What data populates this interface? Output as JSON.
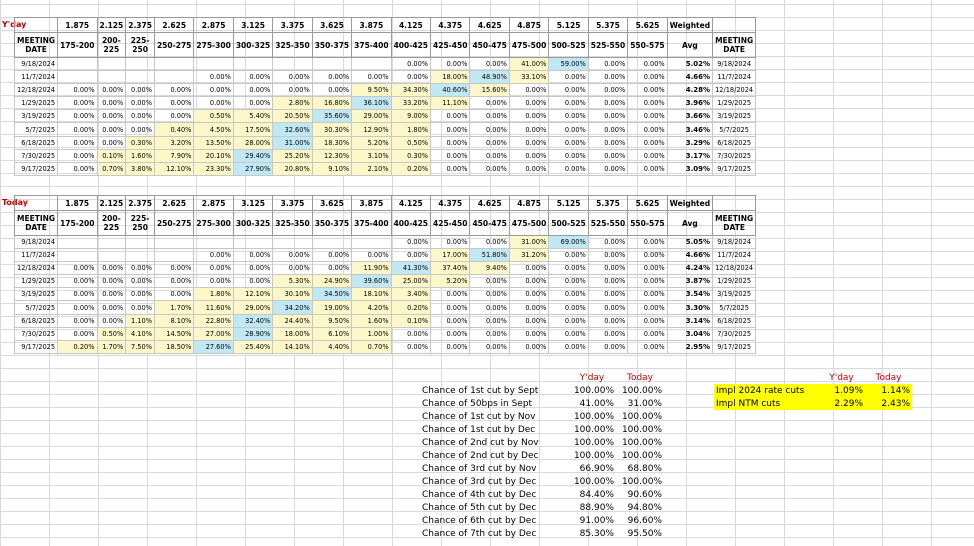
{
  "bucket_mids": [
    "1.875",
    "2.125",
    "2.375",
    "2.625",
    "2.875",
    "3.125",
    "3.375",
    "3.625",
    "3.875",
    "4.125",
    "4.375",
    "4.625",
    "4.875",
    "5.125",
    "5.375",
    "5.625"
  ],
  "weighted_label": "Weighted",
  "meeting_date_label": "MEETING DATE",
  "avg_label": "Avg",
  "bucket_ranges": [
    "175-200",
    "200-225",
    "225-250",
    "250-275",
    "275-300",
    "300-325",
    "325-350",
    "350-375",
    "375-400",
    "400-425",
    "425-450",
    "450-475",
    "475-500",
    "500-525",
    "525-550",
    "550-575"
  ],
  "yday": {
    "label": "Y'day",
    "rows": [
      {
        "date": "9/18/2024",
        "cells": [
          "",
          "",
          "",
          "",
          "",
          "",
          "",
          "",
          "",
          "0.00%",
          "0.00%",
          "0.00%",
          "41.00%",
          "59.00%",
          "0.00%",
          "0.00%"
        ],
        "avg": "5.02%",
        "date2": "9/18/2024"
      },
      {
        "date": "11/7/2024",
        "cells": [
          "",
          "",
          "",
          "",
          "0.00%",
          "0.00%",
          "0.00%",
          "0.00%",
          "0.00%",
          "0.00%",
          "18.00%",
          "48.90%",
          "33.10%",
          "0.00%",
          "0.00%",
          "0.00%"
        ],
        "avg": "4.66%",
        "date2": "11/7/2024"
      },
      {
        "date": "12/18/2024",
        "cells": [
          "0.00%",
          "0.00%",
          "0.00%",
          "0.00%",
          "0.00%",
          "0.00%",
          "0.00%",
          "0.00%",
          "9.50%",
          "34.30%",
          "40.60%",
          "15.60%",
          "0.00%",
          "0.00%",
          "0.00%",
          "0.00%"
        ],
        "avg": "4.28%",
        "date2": "12/18/2024"
      },
      {
        "date": "1/29/2025",
        "cells": [
          "0.00%",
          "0.00%",
          "0.00%",
          "0.00%",
          "0.00%",
          "0.00%",
          "2.80%",
          "16.80%",
          "36.10%",
          "33.20%",
          "11.10%",
          "0.00%",
          "0.00%",
          "0.00%",
          "0.00%",
          "0.00%"
        ],
        "avg": "3.96%",
        "date2": "1/29/2025"
      },
      {
        "date": "3/19/2025",
        "cells": [
          "0.00%",
          "0.00%",
          "0.00%",
          "0.00%",
          "0.50%",
          "5.40%",
          "20.50%",
          "35.60%",
          "29.00%",
          "9.00%",
          "0.00%",
          "0.00%",
          "0.00%",
          "0.00%",
          "0.00%",
          "0.00%"
        ],
        "avg": "3.66%",
        "date2": "3/19/2025"
      },
      {
        "date": "5/7/2025",
        "cells": [
          "0.00%",
          "0.00%",
          "0.00%",
          "0.40%",
          "4.50%",
          "17.50%",
          "32.60%",
          "30.30%",
          "12.90%",
          "1.80%",
          "0.00%",
          "0.00%",
          "0.00%",
          "0.00%",
          "0.00%",
          "0.00%"
        ],
        "avg": "3.46%",
        "date2": "5/7/2025"
      },
      {
        "date": "6/18/2025",
        "cells": [
          "0.00%",
          "0.00%",
          "0.30%",
          "3.20%",
          "13.50%",
          "28.00%",
          "31.00%",
          "18.30%",
          "5.20%",
          "0.50%",
          "0.00%",
          "0.00%",
          "0.00%",
          "0.00%",
          "0.00%",
          "0.00%"
        ],
        "avg": "3.29%",
        "date2": "6/18/2025"
      },
      {
        "date": "7/30/2025",
        "cells": [
          "0.00%",
          "0.10%",
          "1.60%",
          "7.90%",
          "20.10%",
          "29.40%",
          "25.20%",
          "12.30%",
          "3.10%",
          "0.30%",
          "0.00%",
          "0.00%",
          "0.00%",
          "0.00%",
          "0.00%",
          "0.00%"
        ],
        "avg": "3.17%",
        "date2": "7/30/2025"
      },
      {
        "date": "9/17/2025",
        "cells": [
          "0.00%",
          "0.70%",
          "3.80%",
          "12.10%",
          "23.30%",
          "27.90%",
          "20.80%",
          "9.10%",
          "2.10%",
          "0.20%",
          "0.00%",
          "0.00%",
          "0.00%",
          "0.00%",
          "0.00%",
          "0.00%"
        ],
        "avg": "3.09%",
        "date2": "9/17/2025"
      }
    ]
  },
  "today": {
    "label": "Today",
    "rows": [
      {
        "date": "9/18/2024",
        "cells": [
          "",
          "",
          "",
          "",
          "",
          "",
          "",
          "",
          "",
          "0.00%",
          "0.00%",
          "0.00%",
          "31.00%",
          "69.00%",
          "0.00%",
          "0.00%"
        ],
        "avg": "5.05%",
        "date2": "9/18/2024"
      },
      {
        "date": "11/7/2024",
        "cells": [
          "",
          "",
          "",
          "",
          "0.00%",
          "0.00%",
          "0.00%",
          "0.00%",
          "0.00%",
          "0.00%",
          "17.00%",
          "51.80%",
          "31.20%",
          "0.00%",
          "0.00%",
          "0.00%"
        ],
        "avg": "4.66%",
        "date2": "11/7/2024"
      },
      {
        "date": "12/18/2024",
        "cells": [
          "0.00%",
          "0.00%",
          "0.00%",
          "0.00%",
          "0.00%",
          "0.00%",
          "0.00%",
          "0.00%",
          "11.90%",
          "41.30%",
          "37.40%",
          "9.40%",
          "0.00%",
          "0.00%",
          "0.00%",
          "0.00%"
        ],
        "avg": "4.24%",
        "date2": "12/18/2024"
      },
      {
        "date": "1/29/2025",
        "cells": [
          "0.00%",
          "0.00%",
          "0.00%",
          "0.00%",
          "0.00%",
          "0.00%",
          "5.30%",
          "24.90%",
          "39.60%",
          "25.00%",
          "5.20%",
          "0.00%",
          "0.00%",
          "0.00%",
          "0.00%",
          "0.00%"
        ],
        "avg": "3.87%",
        "date2": "1/29/2025"
      },
      {
        "date": "3/19/2025",
        "cells": [
          "0.00%",
          "0.00%",
          "0.00%",
          "0.00%",
          "1.80%",
          "12.10%",
          "30.10%",
          "34.50%",
          "18.10%",
          "3.40%",
          "0.00%",
          "0.00%",
          "0.00%",
          "0.00%",
          "0.00%",
          "0.00%"
        ],
        "avg": "3.54%",
        "date2": "3/19/2025"
      },
      {
        "date": "5/7/2025",
        "cells": [
          "0.00%",
          "0.00%",
          "0.00%",
          "1.70%",
          "11.60%",
          "29.00%",
          "34.20%",
          "19.00%",
          "4.20%",
          "0.20%",
          "0.00%",
          "0.00%",
          "0.00%",
          "0.00%",
          "0.00%",
          "0.00%"
        ],
        "avg": "3.30%",
        "date2": "5/7/2025"
      },
      {
        "date": "6/18/2025",
        "cells": [
          "0.00%",
          "0.00%",
          "1.10%",
          "8.10%",
          "22.80%",
          "32.40%",
          "24.40%",
          "9.50%",
          "1.60%",
          "0.10%",
          "0.00%",
          "0.00%",
          "0.00%",
          "0.00%",
          "0.00%",
          "0.00%"
        ],
        "avg": "3.14%",
        "date2": "6/18/2025"
      },
      {
        "date": "7/30/2025",
        "cells": [
          "0.00%",
          "0.50%",
          "4.10%",
          "14.50%",
          "27.00%",
          "28.90%",
          "18.00%",
          "6.10%",
          "1.00%",
          "0.00%",
          "0.00%",
          "0.00%",
          "0.00%",
          "0.00%",
          "0.00%",
          "0.00%"
        ],
        "avg": "3.04%",
        "date2": "7/30/2025"
      },
      {
        "date": "9/17/2025",
        "cells": [
          "0.20%",
          "1.70%",
          "7.50%",
          "18.50%",
          "27.60%",
          "25.40%",
          "14.10%",
          "4.40%",
          "0.70%",
          "0.00%",
          "0.00%",
          "0.00%",
          "0.00%",
          "0.00%",
          "0.00%",
          "0.00%"
        ],
        "avg": "2.95%",
        "date2": "9/17/2025"
      }
    ]
  },
  "summary": {
    "col_yday": "Y'day",
    "col_today": "Today",
    "rows": [
      {
        "label": "Chance of 1st cut by Sept",
        "yday": "100.00%",
        "today": "100.00%"
      },
      {
        "label": "Chance of 50bps in Sept",
        "yday": "41.00%",
        "today": "31.00%"
      },
      {
        "label": "Chance of 1st cut by Nov",
        "yday": "100.00%",
        "today": "100.00%"
      },
      {
        "label": "Chance of 1st cut by Dec",
        "yday": "100.00%",
        "today": "100.00%"
      },
      {
        "label": "Chance of 2nd cut by Nov",
        "yday": "100.00%",
        "today": "100.00%"
      },
      {
        "label": "Chance of 2nd cut by Dec",
        "yday": "100.00%",
        "today": "100.00%"
      },
      {
        "label": "Chance of 3rd cut by Nov",
        "yday": "66.90%",
        "today": "68.80%"
      },
      {
        "label": "Chance of 3rd cut by Dec",
        "yday": "100.00%",
        "today": "100.00%"
      },
      {
        "label": "Chance of 4th cut by Dec",
        "yday": "84.40%",
        "today": "90.60%"
      },
      {
        "label": "Chance of 5th cut by Dec",
        "yday": "88.90%",
        "today": "94.80%"
      },
      {
        "label": "Chance of 6th cut by Dec",
        "yday": "91.00%",
        "today": "96.60%"
      },
      {
        "label": "Chance of 7th cut by Dec",
        "yday": "85.30%",
        "today": "95.50%"
      }
    ]
  },
  "implied": {
    "col_yday": "Y'day",
    "col_today": "Today",
    "rows": [
      {
        "label": "Impl 2024 rate cuts",
        "yday": "1.09%",
        "today": "1.14%"
      },
      {
        "label": "Impl NTM cuts",
        "yday": "2.29%",
        "today": "2.43%"
      }
    ]
  },
  "colors": {
    "label_red": "#c00000",
    "highlight_yellow": "#fbf7c8",
    "highlight_blue": "#bfe8f4",
    "impl_yellow": "#ffff00"
  }
}
